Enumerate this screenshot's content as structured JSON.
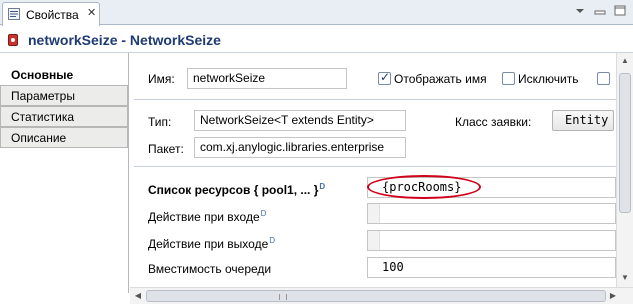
{
  "tab": {
    "label": "Свойства",
    "close": "✕"
  },
  "header": {
    "title": "networkSeize - NetworkSeize"
  },
  "nav": {
    "items": [
      {
        "label": "Основные",
        "active": true
      },
      {
        "label": "Параметры",
        "active": false
      },
      {
        "label": "Статистика",
        "active": false
      },
      {
        "label": "Описание",
        "active": false
      }
    ]
  },
  "form": {
    "name_label": "Имя:",
    "name_value": "networkSeize",
    "show_name_label": "Отображать имя",
    "show_name_checked": true,
    "exclude_label": "Исключить",
    "exclude_checked": false,
    "type_label": "Тип:",
    "type_value": "NetworkSeize<T extends Entity>",
    "request_class_label": "Класс заявки:",
    "request_class_value": "Entity",
    "package_label": "Пакет:",
    "package_value": "com.xj.anylogic.libraries.enterprise",
    "resources_label": "Список ресурсов { pool1, ... }",
    "resources_sup": "D",
    "resources_value": "{procRooms}",
    "on_enter_label": "Действие при входе",
    "on_enter_sup": "D",
    "on_exit_label": "Действие при выходе",
    "on_exit_sup": "D",
    "queue_capacity_label": "Вместимость очереди",
    "queue_capacity_value": "100"
  },
  "colors": {
    "highlight": "#d0021b",
    "title": "#1f3b73"
  }
}
